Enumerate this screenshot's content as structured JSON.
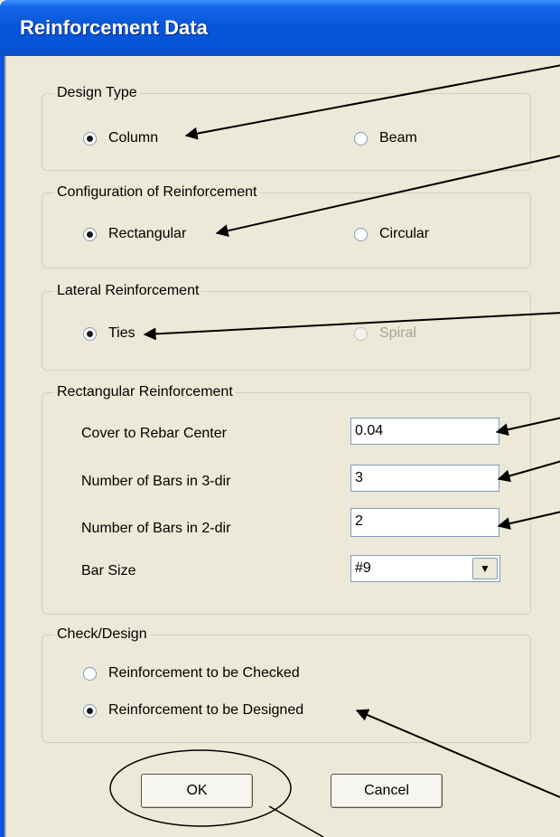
{
  "window": {
    "title": "Reinforcement Data"
  },
  "design_type": {
    "legend": "Design Type",
    "options": [
      {
        "label": "Column",
        "selected": true,
        "enabled": true
      },
      {
        "label": "Beam",
        "selected": false,
        "enabled": true
      }
    ]
  },
  "configuration": {
    "legend": "Configuration of Reinforcement",
    "options": [
      {
        "label": "Rectangular",
        "selected": true,
        "enabled": true
      },
      {
        "label": "Circular",
        "selected": false,
        "enabled": true
      }
    ]
  },
  "lateral": {
    "legend": "Lateral Reinforcement",
    "options": [
      {
        "label": "Ties",
        "selected": true,
        "enabled": true
      },
      {
        "label": "Spiral",
        "selected": false,
        "enabled": false
      }
    ]
  },
  "rectangular": {
    "legend": "Rectangular Reinforcement",
    "cover_label": "Cover to Rebar Center",
    "cover_value": "0.04",
    "bars3_label": "Number of Bars in 3-dir",
    "bars3_value": "3",
    "bars2_label": "Number of Bars in 2-dir",
    "bars2_value": "2",
    "barsize_label": "Bar Size",
    "barsize_value": "#9"
  },
  "check_design": {
    "legend": "Check/Design",
    "options": [
      {
        "label": "Reinforcement to be Checked",
        "selected": false,
        "enabled": true
      },
      {
        "label": "Reinforcement to be Designed",
        "selected": true,
        "enabled": true
      }
    ]
  },
  "buttons": {
    "ok": "OK",
    "cancel": "Cancel"
  },
  "colors": {
    "titlebar": "#0553d6",
    "dialog_bg": "#ece9d8",
    "annotation": "#000000"
  }
}
